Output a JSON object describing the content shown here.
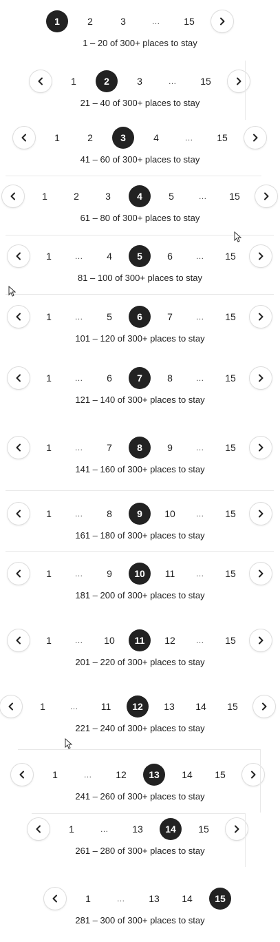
{
  "blocks": [
    {
      "prev": false,
      "next": true,
      "items": [
        "1",
        "2",
        "3",
        "…",
        "15"
      ],
      "active": "1",
      "caption": "1 – 20 of 300+ places to stay"
    },
    {
      "prev": true,
      "next": true,
      "items": [
        "1",
        "2",
        "3",
        "…",
        "15"
      ],
      "active": "2",
      "caption": "21 – 40 of 300+ places to stay"
    },
    {
      "prev": true,
      "next": true,
      "items": [
        "1",
        "2",
        "3",
        "4",
        "…",
        "15"
      ],
      "active": "3",
      "caption": "41 – 60 of 300+ places to stay"
    },
    {
      "prev": true,
      "next": true,
      "items": [
        "1",
        "2",
        "3",
        "4",
        "5",
        "…",
        "15"
      ],
      "active": "4",
      "caption": "61 – 80 of 300+ places to stay"
    },
    {
      "prev": true,
      "next": true,
      "items": [
        "1",
        "…",
        "4",
        "5",
        "6",
        "…",
        "15"
      ],
      "active": "5",
      "caption": "81 – 100 of 300+ places to stay"
    },
    {
      "prev": true,
      "next": true,
      "items": [
        "1",
        "…",
        "5",
        "6",
        "7",
        "…",
        "15"
      ],
      "active": "6",
      "caption": "101 – 120 of 300+ places to stay"
    },
    {
      "prev": true,
      "next": true,
      "items": [
        "1",
        "…",
        "6",
        "7",
        "8",
        "…",
        "15"
      ],
      "active": "7",
      "caption": "121 – 140 of 300+ places to stay"
    },
    {
      "prev": true,
      "next": true,
      "items": [
        "1",
        "…",
        "7",
        "8",
        "9",
        "…",
        "15"
      ],
      "active": "8",
      "caption": "141 – 160 of 300+ places to stay"
    },
    {
      "prev": true,
      "next": true,
      "items": [
        "1",
        "…",
        "8",
        "9",
        "10",
        "…",
        "15"
      ],
      "active": "9",
      "caption": "161 – 180 of 300+ places to stay"
    },
    {
      "prev": true,
      "next": true,
      "items": [
        "1",
        "…",
        "9",
        "10",
        "11",
        "…",
        "15"
      ],
      "active": "10",
      "caption": "181 – 200 of 300+ places to stay"
    },
    {
      "prev": true,
      "next": true,
      "items": [
        "1",
        "…",
        "10",
        "11",
        "12",
        "…",
        "15"
      ],
      "active": "11",
      "caption": "201 – 220 of 300+ places to stay"
    },
    {
      "prev": true,
      "next": true,
      "items": [
        "1",
        "…",
        "11",
        "12",
        "13",
        "14",
        "15"
      ],
      "active": "12",
      "caption": "221 – 240 of 300+ places to stay"
    },
    {
      "prev": true,
      "next": true,
      "items": [
        "1",
        "…",
        "12",
        "13",
        "14",
        "15"
      ],
      "active": "13",
      "caption": "241 – 260 of 300+ places to stay"
    },
    {
      "prev": true,
      "next": true,
      "items": [
        "1",
        "…",
        "13",
        "14",
        "15"
      ],
      "active": "14",
      "caption": "261 – 280 of 300+ places to stay"
    },
    {
      "prev": true,
      "next": false,
      "items": [
        "1",
        "…",
        "13",
        "14",
        "15"
      ],
      "active": "15",
      "caption": "281 – 300 of 300+ places to stay"
    }
  ],
  "icons": {
    "prev": "chevron-left-icon",
    "next": "chevron-right-icon"
  },
  "colors": {
    "active_bg": "#222222",
    "active_text": "#ffffff",
    "text": "#222222",
    "divider": "#e8e8e8"
  }
}
